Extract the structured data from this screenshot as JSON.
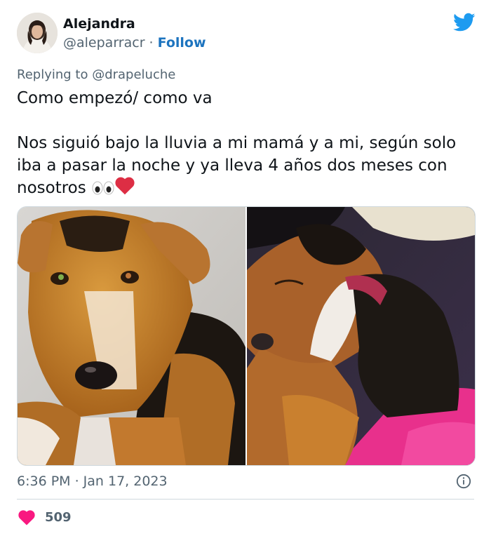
{
  "author": {
    "display_name": "Alejandra",
    "handle": "@aleparracr",
    "separator": " · ",
    "follow_label": "Follow"
  },
  "reply": {
    "label": "Replying to @drapeluche"
  },
  "tweet": {
    "line1": "Como empezó/ como va",
    "body": "Nos siguió bajo la lluvia a mi mamá y a mi, según solo iba a pasar la noche y ya lleva 4 años dos meses con nosotros",
    "emojis": [
      "eyes-emoji",
      "red-heart-emoji"
    ]
  },
  "media": {
    "photos": [
      "dog-photo-then",
      "dog-photo-now"
    ]
  },
  "meta": {
    "timestamp": "6:36 PM · Jan 17, 2023"
  },
  "engagement": {
    "likes": "509"
  },
  "colors": {
    "twitter_blue": "#1d9bf0",
    "follow_blue": "#1d74bf",
    "like_pink": "#f91880",
    "secondary_text": "#536471"
  }
}
